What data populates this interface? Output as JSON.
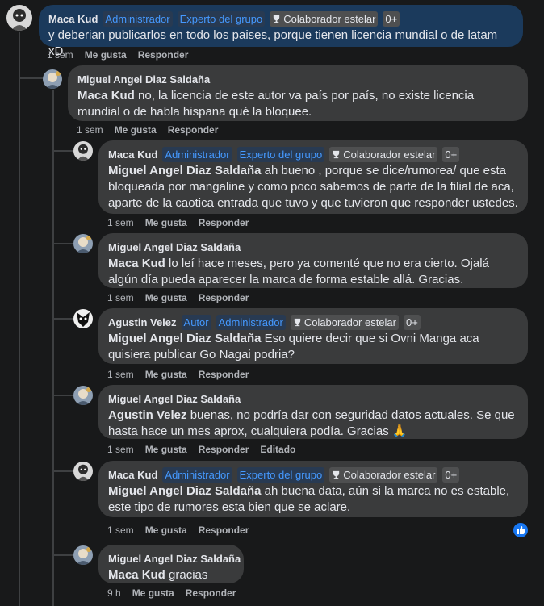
{
  "badges": {
    "admin": "Administrador",
    "expert": "Experto del grupo",
    "star": "Colaborador estelar",
    "count": "0+",
    "author": "Autor"
  },
  "actions": {
    "like": "Me gusta",
    "reply": "Responder",
    "edited": "Editado"
  },
  "comments": [
    {
      "author": "Maca Kud",
      "time": "1 sem",
      "mention": "",
      "text": "y deberian publicarlos en todo los paises, porque tienen licencia mundial o de latam xD"
    },
    {
      "author": "Miguel Angel Diaz Saldaña",
      "time": "1 sem",
      "mention": "Maca Kud",
      "text": " no, la licencia de este autor va país por país, no existe licencia mundial o de habla hispana qué la bloquee."
    },
    {
      "author": "Maca Kud",
      "time": "1 sem",
      "mention": "Miguel Angel Diaz Saldaña",
      "text": " ah bueno , porque se dice/rumorea/ que esta bloqueada por mangaline y como poco sabemos de parte de la filial de aca, aparte de la caotica entrada que tuvo y que tuvieron que responder ustedes."
    },
    {
      "author": "Miguel Angel Diaz Saldaña",
      "time": "1 sem",
      "mention": "Maca Kud",
      "text": " lo leí hace meses, pero ya comenté que no era cierto. Ojalá algún día pueda aparecer la marca de forma estable allá. Gracias."
    },
    {
      "author": "Agustin Velez",
      "time": "1 sem",
      "mention": "Miguel Angel Diaz Saldaña",
      "text": " Eso quiere decir que si Ovni Manga aca quisiera publicar Go Nagai podria?"
    },
    {
      "author": "Miguel Angel Diaz Saldaña",
      "time": "1 sem",
      "mention": "Agustin Velez",
      "text": " buenas, no podría dar con seguridad datos actuales. Se que hasta hace un mes aprox, cualquiera podía. Gracias 🙏"
    },
    {
      "author": "Maca Kud",
      "time": "1 sem",
      "mention": "Miguel Angel Diaz Saldaña",
      "text": " ah buena data, aún si la marca no es estable, este tipo de rumores esta bien que se aclare."
    },
    {
      "author": "Miguel Angel Diaz Saldaña",
      "time": "9 h",
      "mention": "Maca Kud",
      "text": " gracias"
    }
  ]
}
